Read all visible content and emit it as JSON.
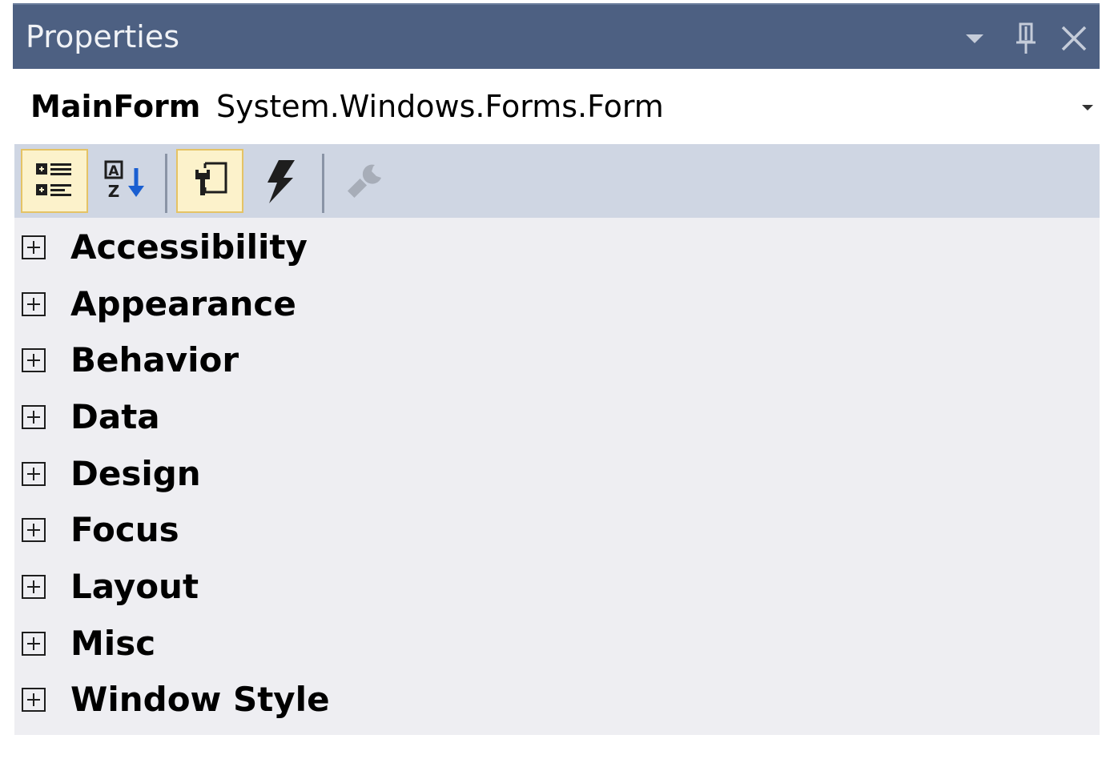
{
  "window": {
    "title": "Properties"
  },
  "object_selector": {
    "name": "MainForm",
    "type": "System.Windows.Forms.Form"
  },
  "toolbar": {
    "buttons": [
      {
        "icon": "categorized-icon",
        "active": true
      },
      {
        "icon": "alphabetical-icon",
        "active": false
      },
      {
        "icon": "properties-icon",
        "active": true
      },
      {
        "icon": "events-icon",
        "active": false
      },
      {
        "icon": "property-pages-icon",
        "active": false,
        "disabled": true
      }
    ]
  },
  "categories": [
    {
      "label": "Accessibility"
    },
    {
      "label": "Appearance"
    },
    {
      "label": "Behavior"
    },
    {
      "label": "Data"
    },
    {
      "label": "Design"
    },
    {
      "label": "Focus"
    },
    {
      "label": "Layout"
    },
    {
      "label": "Misc"
    },
    {
      "label": "Window Style"
    }
  ],
  "colors": {
    "titlebar": "#4d6082",
    "toolbar": "#cfd6e3",
    "grid_background": "#eeeef2",
    "active_button": "#fcf2cb",
    "active_button_border": "#e5c365"
  }
}
